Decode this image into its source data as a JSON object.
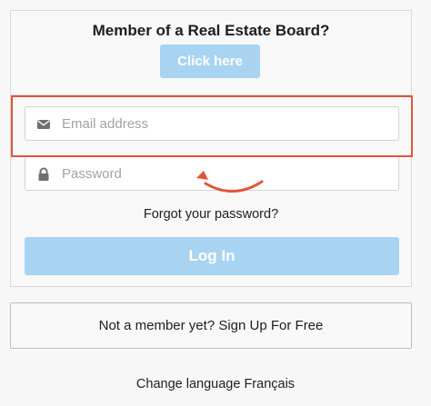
{
  "board": {
    "title": "Member of a Real Estate Board?",
    "click_label": "Click here"
  },
  "login": {
    "email_placeholder": "Email address",
    "email_icon": "envelope-icon",
    "password_placeholder": "Password",
    "password_icon": "lock-icon",
    "forgot_label": "Forgot your password?",
    "login_label": "Log In"
  },
  "signup": {
    "label": "Not a member yet? Sign Up For Free"
  },
  "language": {
    "prefix": "Change language",
    "option": "Français"
  },
  "colors": {
    "button_fill": "#a8d4f2",
    "highlight": "#e0553a",
    "icon": "#6f6f73"
  }
}
